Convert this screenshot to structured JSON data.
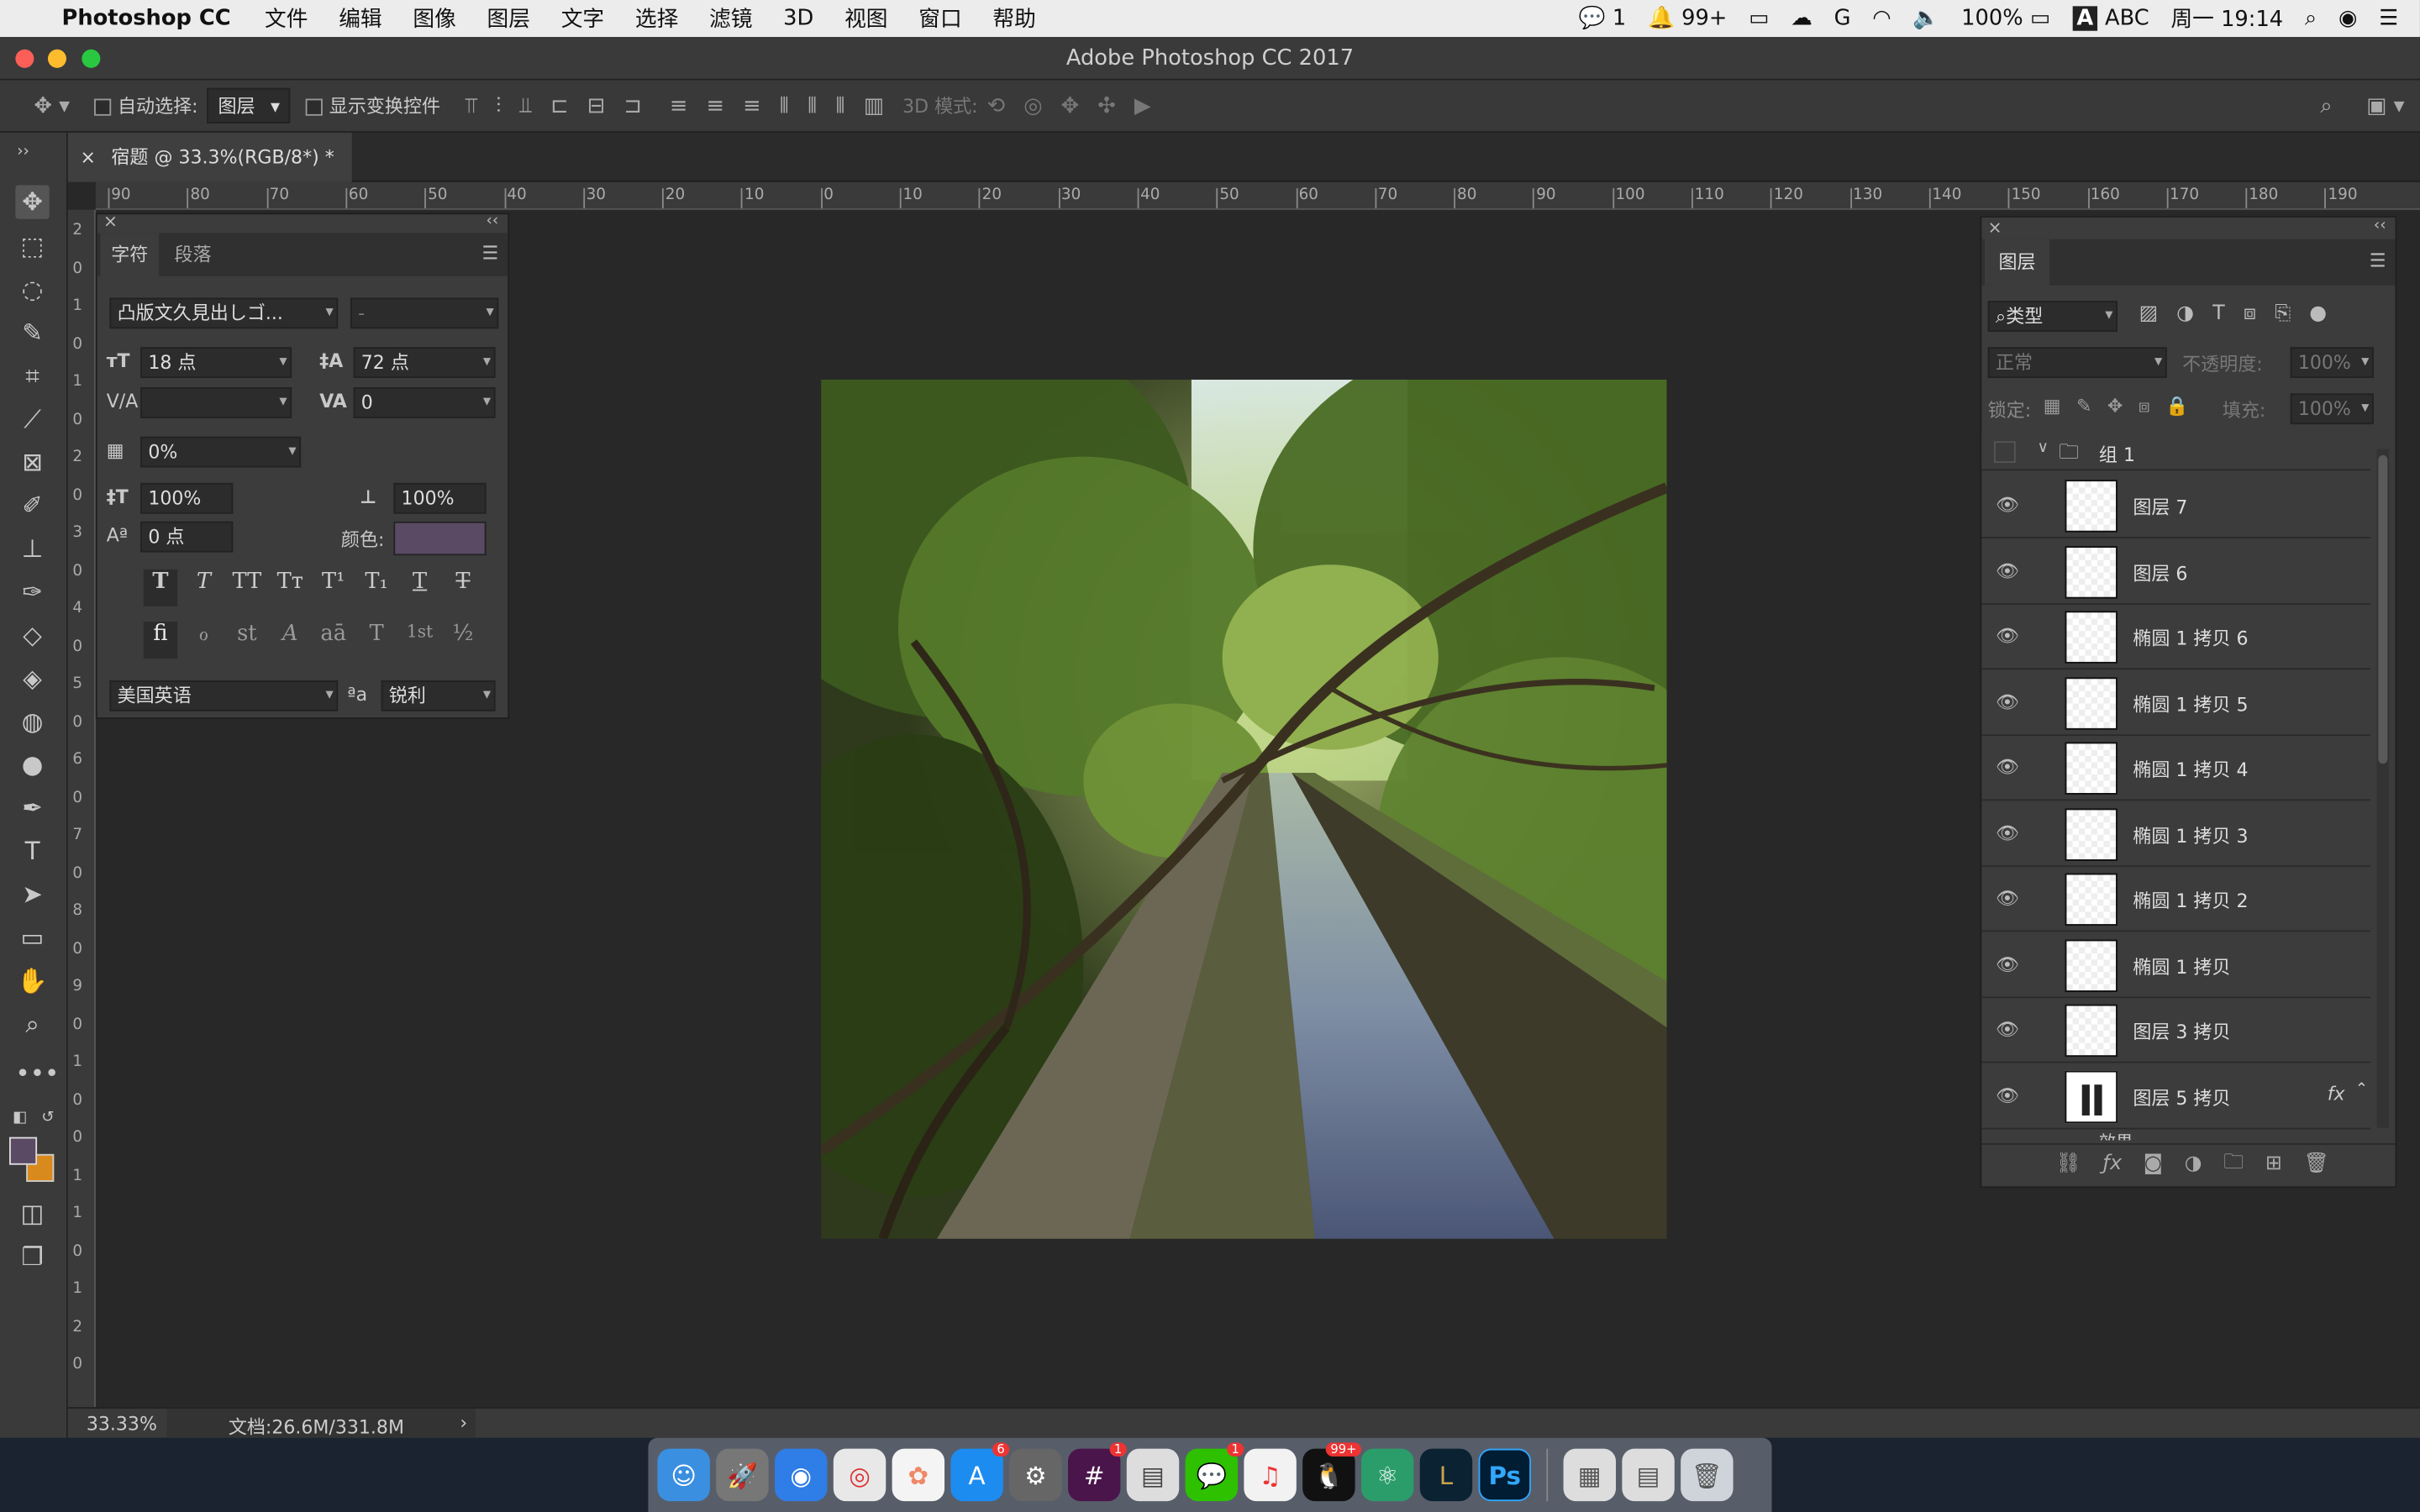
{
  "menubar": {
    "app": "Photoshop CC",
    "items": [
      "文件",
      "编辑",
      "图像",
      "图层",
      "文字",
      "选择",
      "滤镜",
      "3D",
      "视图",
      "窗口",
      "帮助"
    ],
    "status": {
      "wechat_count": "1",
      "qq_count": "99+",
      "battery": "100%",
      "input": "ABC",
      "clock": "周一 19:14"
    }
  },
  "window": {
    "title": "Adobe Photoshop CC 2017"
  },
  "options": {
    "auto_select_label": "自动选择:",
    "auto_select_value": "图层",
    "show_transform_label": "显示变换控件",
    "mode_3d_label": "3D 模式:"
  },
  "document": {
    "tab": "宿题 @ 33.3%(RGB/8*) *"
  },
  "rulers": {
    "h": [
      "90",
      "80",
      "70",
      "60",
      "50",
      "40",
      "30",
      "20",
      "10",
      "0",
      "10",
      "20",
      "30",
      "40",
      "50",
      "60",
      "70",
      "80",
      "90",
      "100",
      "110",
      "120",
      "130",
      "140",
      "150",
      "160",
      "170",
      "180",
      "190"
    ],
    "v": [
      "2",
      "0",
      "1",
      "0",
      "1",
      "0",
      "2",
      "0",
      "3",
      "0",
      "4",
      "0",
      "5",
      "0",
      "6",
      "0",
      "7",
      "0",
      "8",
      "0",
      "9",
      "0",
      "1",
      "0",
      "0",
      "1",
      "1",
      "0",
      "1",
      "2",
      "0"
    ]
  },
  "character_panel": {
    "tabs": [
      "字符",
      "段落"
    ],
    "font_family": "凸版文久見出しゴ...",
    "font_style": "-",
    "font_size": "18 点",
    "leading": "72 点",
    "kerning": "",
    "tracking": "0",
    "tsume": "0%",
    "vscale": "100%",
    "hscale": "100%",
    "baseline": "0 点",
    "color_label": "颜色:",
    "color": "#5a4a63",
    "style_buttons": [
      "T",
      "T",
      "TT",
      "Tт",
      "T¹",
      "T₁",
      "T",
      "T"
    ],
    "opentype_buttons": [
      "fi",
      "ℴ",
      "st",
      "A",
      "aā",
      "T",
      "1st",
      "½"
    ],
    "language": "美国英语",
    "aa_icon": "ªa",
    "antialias": "锐利"
  },
  "layers_panel": {
    "tab": "图层",
    "filter_kind": "类型",
    "blend_mode": "正常",
    "opacity_label": "不透明度:",
    "opacity": "100%",
    "lock_label": "锁定:",
    "fill_label": "填充:",
    "fill": "100%",
    "group": "组 1",
    "layers": [
      "图层 7",
      "图层 6",
      "椭圆 1 拷贝 6",
      "椭圆 1 拷贝 5",
      "椭圆 1 拷贝 4",
      "椭圆 1 拷贝 3",
      "椭圆 1 拷贝 2",
      "椭圆 1 拷贝",
      "图层 3 拷贝",
      "图层 5 拷贝"
    ],
    "fx": "fx",
    "partial_next": "效果"
  },
  "statusbar": {
    "zoom": "33.33%",
    "doc": "文档:26.6M/331.8M"
  },
  "dock": {
    "badges": {
      "appstore": "6",
      "slack": "1",
      "wechat": "1",
      "qq": "99+"
    }
  },
  "colors": {
    "fg": "#5a4a63",
    "bg": "#d98a1c"
  }
}
